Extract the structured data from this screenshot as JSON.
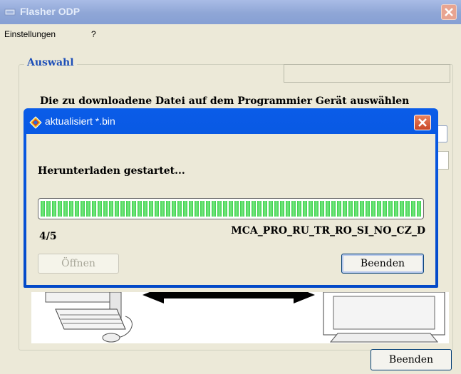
{
  "main_window": {
    "title": "Flasher ODP",
    "menu": [
      "Einstellungen",
      "?"
    ],
    "group_label": "Auswahl",
    "instruction": "Die zu downloadene Datei auf dem Programmier Gerät auswählen",
    "bottom_button": "Beenden"
  },
  "dialog": {
    "title": "aktualisiert *.bin",
    "status": "Herunterladen gestartet...",
    "progress_fraction": 1.0,
    "counter": "4/5",
    "filename": "MCA_PRO_RU_TR_RO_SI_NO_CZ_D",
    "open_button": "Öffnen",
    "close_button": "Beenden"
  },
  "colors": {
    "titlebar_active": "#0a5ce8",
    "progress_green": "#3ad04a",
    "group_label": "#1d4fb8"
  },
  "icons": [
    "app-icon",
    "close-icon",
    "update-icon",
    "computer-icon",
    "arrow-icon"
  ]
}
